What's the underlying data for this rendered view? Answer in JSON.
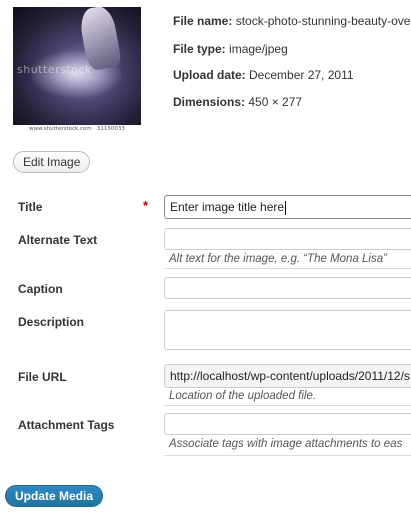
{
  "thumbnail": {
    "watermark_text": "shutterstock",
    "credit_text": "www.shutterstock.com · 31150033"
  },
  "file_info": {
    "file_name_label": "File name:",
    "file_name_value": "stock-photo-stunning-beauty-ove",
    "file_type_label": "File type:",
    "file_type_value": "image/jpeg",
    "upload_date_label": "Upload date:",
    "upload_date_value": "December 27, 2011",
    "dimensions_label": "Dimensions:",
    "dimensions_value": "450 × 277"
  },
  "edit_button_label": "Edit Image",
  "fields": {
    "title": {
      "label": "Title",
      "required_marker": "*",
      "value": "Enter image title here"
    },
    "alt": {
      "label": "Alternate Text",
      "value": "",
      "hint": "Alt text for the image, e.g. “The Mona Lisa”"
    },
    "caption": {
      "label": "Caption",
      "value": ""
    },
    "description": {
      "label": "Description",
      "value": ""
    },
    "file_url": {
      "label": "File URL",
      "value": "http://localhost/wp-content/uploads/2011/12/s",
      "hint": "Location of the uploaded file."
    },
    "tags": {
      "label": "Attachment Tags",
      "value": "",
      "hint": "Associate tags with image attachments to eas"
    }
  },
  "update_button_label": "Update Media"
}
